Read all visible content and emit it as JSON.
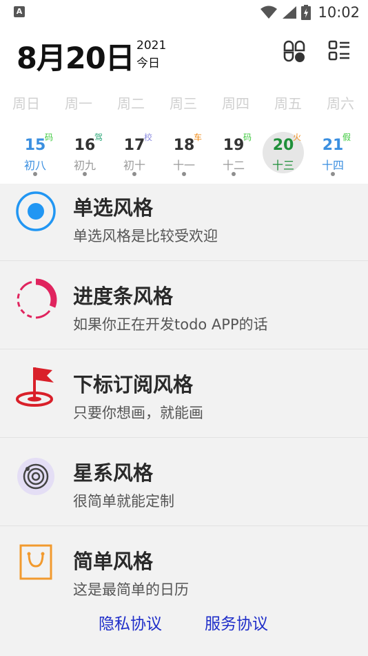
{
  "status_bar": {
    "notification_letter": "A",
    "time": "10:02"
  },
  "header": {
    "date": "8月20日",
    "year": "2021",
    "today_label": "今日"
  },
  "weekdays": [
    "周日",
    "周一",
    "周二",
    "周三",
    "周四",
    "周五",
    "周六"
  ],
  "days": [
    {
      "num": "15",
      "lunar": "初八",
      "tag": "码",
      "tag_color": "#3ec93e",
      "num_color": "#3b8fe0",
      "lunar_color": "#3b8fe0"
    },
    {
      "num": "16",
      "lunar": "初九",
      "tag": "驾",
      "tag_color": "#2fa87a",
      "num_color": "#333333",
      "lunar_color": "#9a9a9a"
    },
    {
      "num": "17",
      "lunar": "初十",
      "tag": "校",
      "tag_color": "#8d8de0",
      "num_color": "#333333",
      "lunar_color": "#9a9a9a"
    },
    {
      "num": "18",
      "lunar": "十一",
      "tag": "车",
      "tag_color": "#f08c1a",
      "num_color": "#333333",
      "lunar_color": "#9a9a9a"
    },
    {
      "num": "19",
      "lunar": "十二",
      "tag": "码",
      "tag_color": "#3ec93e",
      "num_color": "#333333",
      "lunar_color": "#9a9a9a"
    },
    {
      "num": "20",
      "lunar": "十三",
      "tag": "火",
      "tag_color": "#f08c1a",
      "num_color": "#1f8f3a",
      "lunar_color": "#1f8f3a",
      "selected": true
    },
    {
      "num": "21",
      "lunar": "十四",
      "tag": "假",
      "tag_color": "#3ec93e",
      "num_color": "#3b8fe0",
      "lunar_color": "#3b8fe0"
    }
  ],
  "styles_list": [
    {
      "title": "单选风格",
      "subtitle": "单选风格是比较受欢迎",
      "icon": "radio-icon"
    },
    {
      "title": "进度条风格",
      "subtitle": "如果你正在开发todo APP的话",
      "icon": "progress-ring-icon"
    },
    {
      "title": "下标订阅风格",
      "subtitle": "只要你想画，就能画",
      "icon": "flag-icon"
    },
    {
      "title": "星系风格",
      "subtitle": "很简单就能定制",
      "icon": "galaxy-icon"
    },
    {
      "title": "简单风格",
      "subtitle": "这是最简单的日历",
      "icon": "shopping-bag-icon"
    }
  ],
  "footer": {
    "privacy_label": "隐私协议",
    "service_label": "服务协议"
  },
  "colors": {
    "accent_blue": "#2196f3",
    "link_blue": "#1f2ec9",
    "progress_pink": "#e0245e",
    "flag_red": "#d9202a",
    "galaxy_purple": "#e4def5",
    "bag_orange": "#f29a2e"
  }
}
